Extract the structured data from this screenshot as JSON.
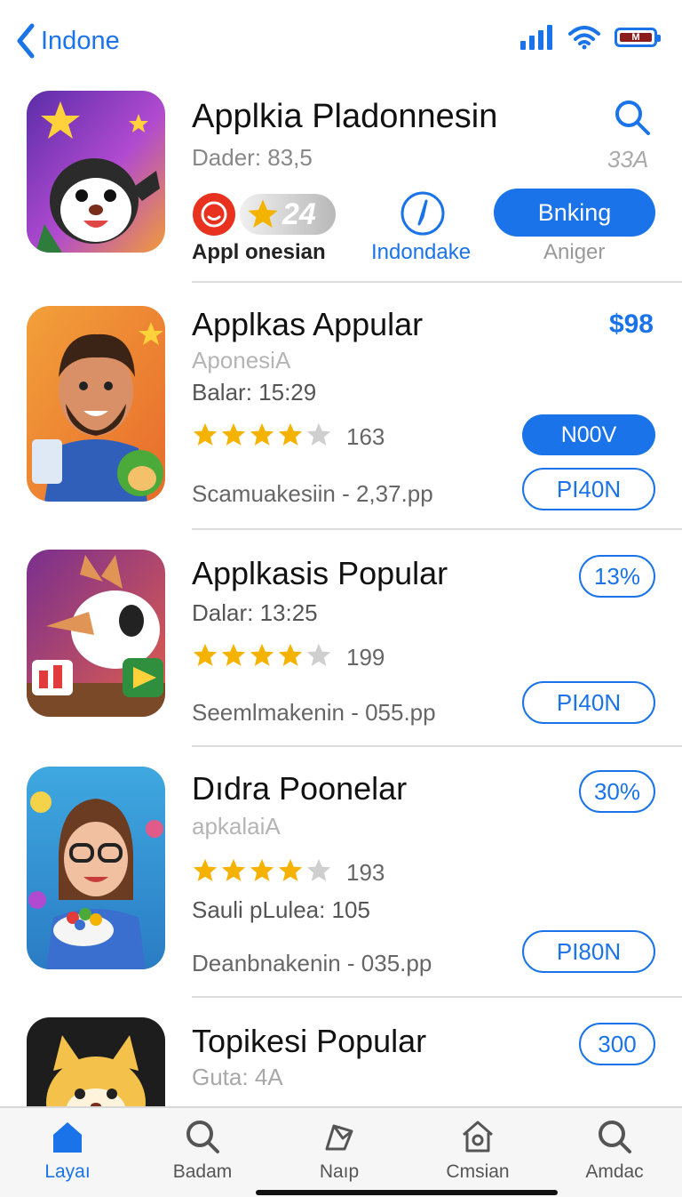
{
  "status": {
    "back_label": "Indone",
    "battery_text": "M"
  },
  "header_app": {
    "title": "Applkia Pladonnesin",
    "dader": "Dader: 83,5",
    "corner_value": "33A",
    "rating_badge": "24",
    "left_label": "Appl onesian",
    "middle_label": "Indondake",
    "button_label": "Bnking",
    "button_caption": "Aniger"
  },
  "apps": [
    {
      "title": "Applkas Appular",
      "subtitle": "AponesiA",
      "info": "Balar: 15:29",
      "rating": 4,
      "reviews": "163",
      "footer": "Scamuakesiin - 2,37.pp",
      "price": "$98",
      "primary_button": "N00V",
      "secondary_button": "PI40N"
    },
    {
      "title": "Applkasis Popular",
      "info": "Dalar: 13:25",
      "rating": 4,
      "reviews": "199",
      "footer": "Seemlmakenin - 055.pp",
      "badge": "13%",
      "secondary_button": "PI40N"
    },
    {
      "title": "Dıdra Poonelar",
      "subtitle": "apkalaiA",
      "rating": 4,
      "reviews": "193",
      "info": "Sauli pLulea: 105",
      "footer": "Deanbnakenin - 035.pp",
      "badge": "30%",
      "secondary_button": "PI80N"
    },
    {
      "title": "Topikesi Popular",
      "subtitle": "Guta: 4A",
      "badge": "300"
    }
  ],
  "tabs": [
    {
      "label": "Layaı",
      "icon": "home-icon",
      "active": true
    },
    {
      "label": "Badam",
      "icon": "search-icon",
      "active": false
    },
    {
      "label": "Naıp",
      "icon": "map-pin-icon",
      "active": false
    },
    {
      "label": "Cmsian",
      "icon": "house-outline-icon",
      "active": false
    },
    {
      "label": "Amdac",
      "icon": "search-icon",
      "active": false
    }
  ],
  "colors": {
    "accent": "#1a73e8",
    "star": "#f5b301",
    "star_empty": "#cfcfcf",
    "divider": "#dcdcdc"
  }
}
